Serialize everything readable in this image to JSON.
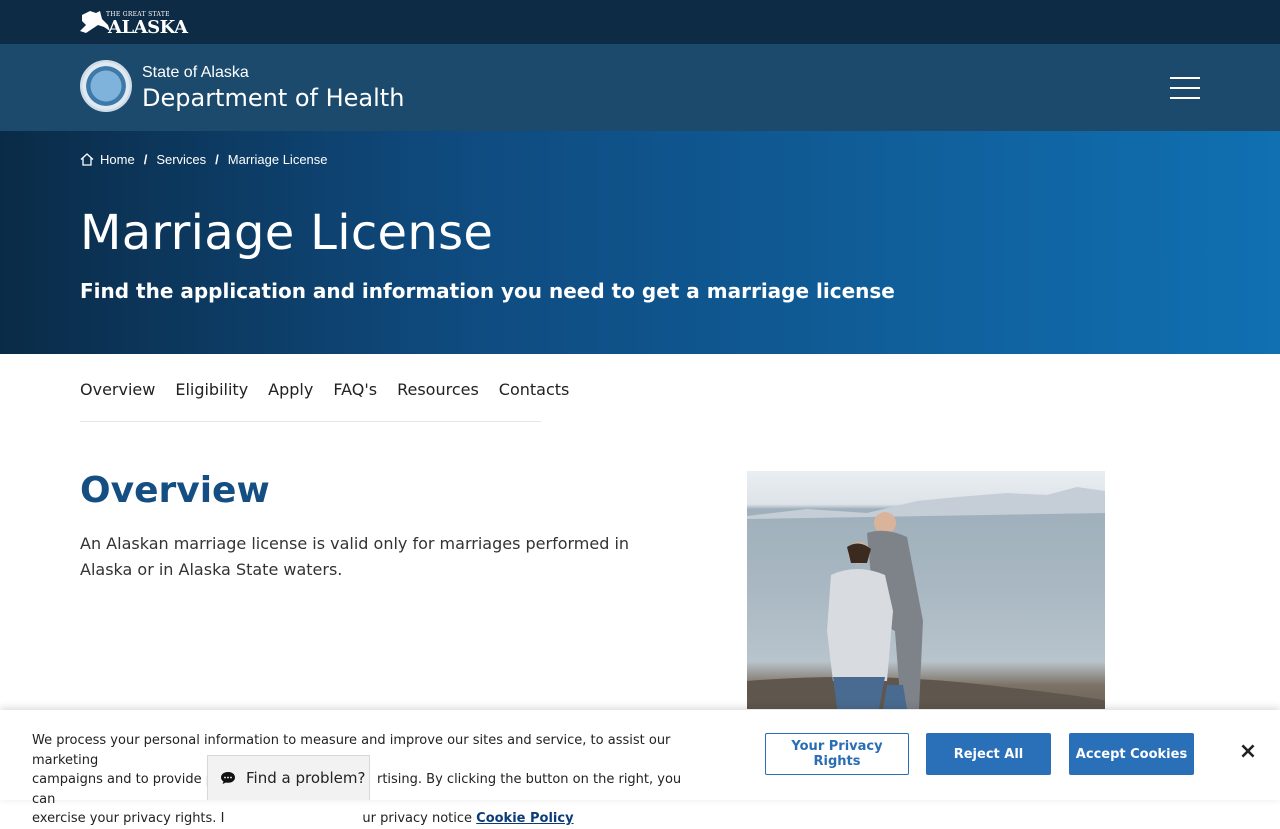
{
  "top": {
    "logo_small": "THE GREAT STATE",
    "logo_of": "of",
    "logo_big": "ALASKA"
  },
  "header": {
    "state": "State of Alaska",
    "department": "Department of Health"
  },
  "breadcrumb": {
    "home": "Home",
    "services": "Services",
    "current": "Marriage License",
    "separator": "/"
  },
  "hero": {
    "title": "Marriage License",
    "subtitle": "Find the application and information you need to get a marriage license"
  },
  "tabs": [
    "Overview",
    "Eligibility",
    "Apply",
    "FAQ's",
    "Resources",
    "Contacts"
  ],
  "overview": {
    "heading": "Overview",
    "text": "An Alaskan marriage license is valid only for marriages performed in Alaska or in Alaska State waters."
  },
  "cookie": {
    "line1": "We process your personal information to measure and improve our sites and service, to assist our marketing",
    "line2": "campaigns and to provide pe",
    "line2b": "rtising. By clicking the button on the right, you can",
    "line3": "exercise your privacy rights. I",
    "line3b": "ur privacy notice",
    "policy_link": "Cookie Policy",
    "privacy_rights": "Your Privacy Rights",
    "reject": "Reject All",
    "accept": "Accept Cookies",
    "close": "×"
  },
  "feedback": {
    "label": "Find a problem?"
  },
  "colors": {
    "topbar": "#0d2b45",
    "deptbar": "#1c4a6d",
    "heading": "#154e82",
    "button": "#2a70b8"
  }
}
